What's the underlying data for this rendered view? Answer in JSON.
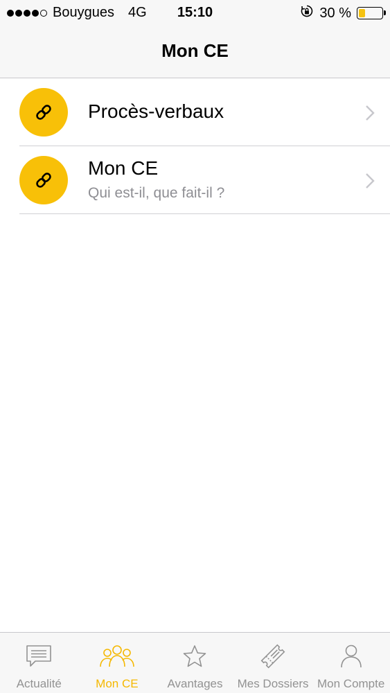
{
  "status_bar": {
    "carrier": "Bouygues",
    "network": "4G",
    "time": "15:10",
    "battery_percent": "30 %",
    "battery_level": 0.3,
    "battery_color": "#f5c211",
    "signal_bars_filled": 4,
    "signal_bars_total": 5
  },
  "nav": {
    "title": "Mon CE"
  },
  "list": {
    "items": [
      {
        "title": "Procès-verbaux",
        "subtitle": "",
        "icon": "link-icon"
      },
      {
        "title": "Mon CE",
        "subtitle": "Qui est-il, que fait-il ?",
        "icon": "link-icon"
      }
    ]
  },
  "tabs": [
    {
      "label": "Actualité",
      "icon": "speech-bubble-icon",
      "active": false
    },
    {
      "label": "Mon CE",
      "icon": "people-icon",
      "active": true
    },
    {
      "label": "Avantages",
      "icon": "star-icon",
      "active": false
    },
    {
      "label": "Mes Dossiers",
      "icon": "ticket-icon",
      "active": false
    },
    {
      "label": "Mon Compte",
      "icon": "person-icon",
      "active": false
    }
  ],
  "colors": {
    "accent": "#f8c008",
    "active_tab": "#f5b800",
    "inactive_tab": "#929292",
    "bar_background": "#f7f7f7"
  }
}
